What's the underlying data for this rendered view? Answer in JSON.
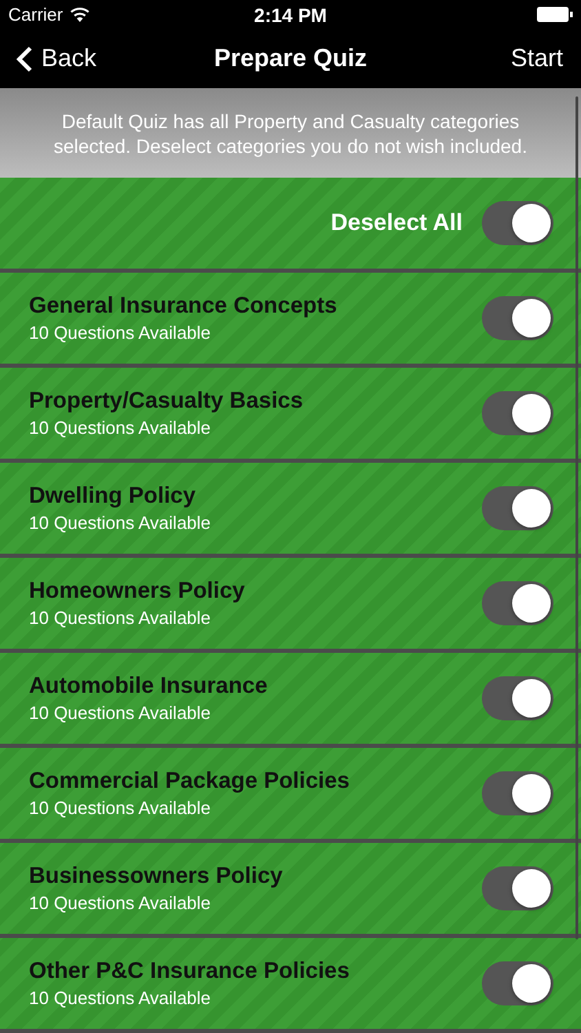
{
  "status_bar": {
    "carrier": "Carrier",
    "time": "2:14 PM"
  },
  "nav": {
    "back": "Back",
    "title": "Prepare Quiz",
    "action": "Start"
  },
  "info": "Default Quiz has all Property and Casualty categories selected. Deselect categories you do not wish included.",
  "deselect_all": {
    "label": "Deselect All",
    "on": true
  },
  "categories": [
    {
      "name": "General Insurance Concepts",
      "count": "10 Questions Available",
      "on": true
    },
    {
      "name": "Property/Casualty Basics",
      "count": "10 Questions Available",
      "on": true
    },
    {
      "name": "Dwelling Policy",
      "count": "10 Questions Available",
      "on": true
    },
    {
      "name": "Homeowners Policy",
      "count": "10 Questions Available",
      "on": true
    },
    {
      "name": "Automobile Insurance",
      "count": "10 Questions Available",
      "on": true
    },
    {
      "name": "Commercial Package Policies",
      "count": "10 Questions Available",
      "on": true
    },
    {
      "name": "Businessowners Policy",
      "count": "10 Questions Available",
      "on": true
    },
    {
      "name": "Other P&C Insurance Policies",
      "count": "10 Questions Available",
      "on": true
    }
  ]
}
